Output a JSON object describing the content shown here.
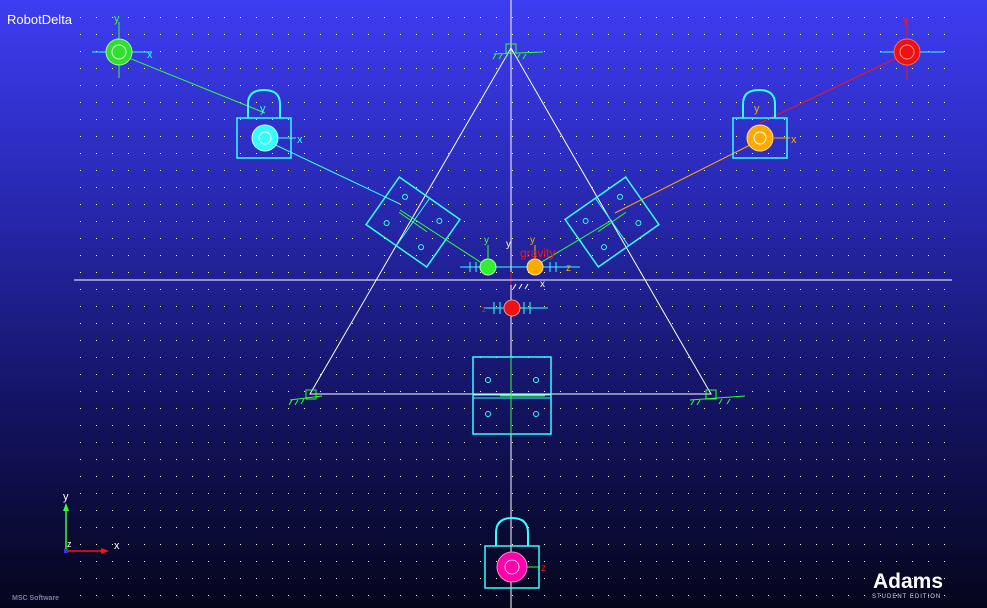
{
  "window": {
    "model_name": "RobotDelta"
  },
  "branding": {
    "product": "Adams",
    "edition": "STUDENT EDITION",
    "vendor": "MSC Software"
  },
  "triad": {
    "x_label": "x",
    "y_label": "y",
    "z_label": "z"
  },
  "scene_labels": {
    "gravity": "gravity",
    "y": "y",
    "x": "x",
    "z": "z"
  },
  "colors": {
    "accent_green": "#33ff33",
    "accent_cyan": "#33ffff",
    "accent_orange": "#ffaa00",
    "accent_red": "#ff1111",
    "accent_magenta": "#ff00aa",
    "grid_dot": "#ffffff",
    "frame_line": "#ffffff"
  }
}
